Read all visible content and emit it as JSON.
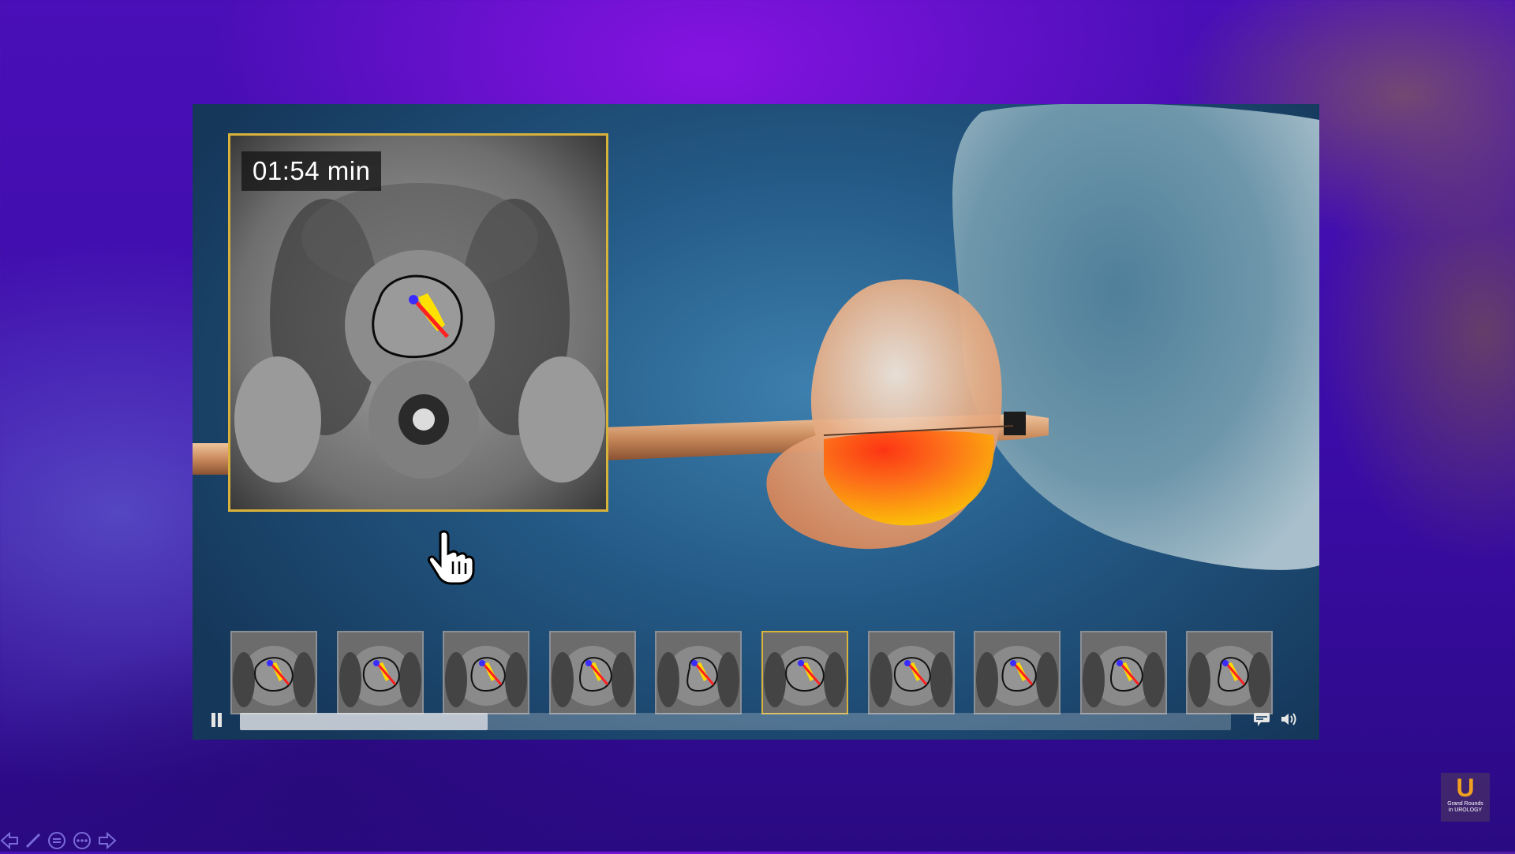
{
  "overlay": {
    "timer_text": "01:54 min"
  },
  "player": {
    "progress": 0.25,
    "play_state": "playing",
    "thumbnail_count": 10,
    "active_thumbnail": 5
  },
  "thumbnails": [
    {
      "index": 0
    },
    {
      "index": 1
    },
    {
      "index": 2
    },
    {
      "index": 3
    },
    {
      "index": 4
    },
    {
      "index": 5
    },
    {
      "index": 6
    },
    {
      "index": 7
    },
    {
      "index": 8
    },
    {
      "index": 9
    }
  ],
  "logo": {
    "letter": "U",
    "line1": "Grand Rounds",
    "line2": "in UROLOGY"
  },
  "colors": {
    "panel_border": "#d8b23a",
    "ablation_hot": "#ff3a10",
    "ablation_warm": "#ffb000",
    "background_purple": "#4a0fb8"
  },
  "icons": {
    "pause": "pause-icon",
    "captions": "captions-icon",
    "volume": "volume-icon",
    "cursor": "hand-cursor-icon"
  }
}
